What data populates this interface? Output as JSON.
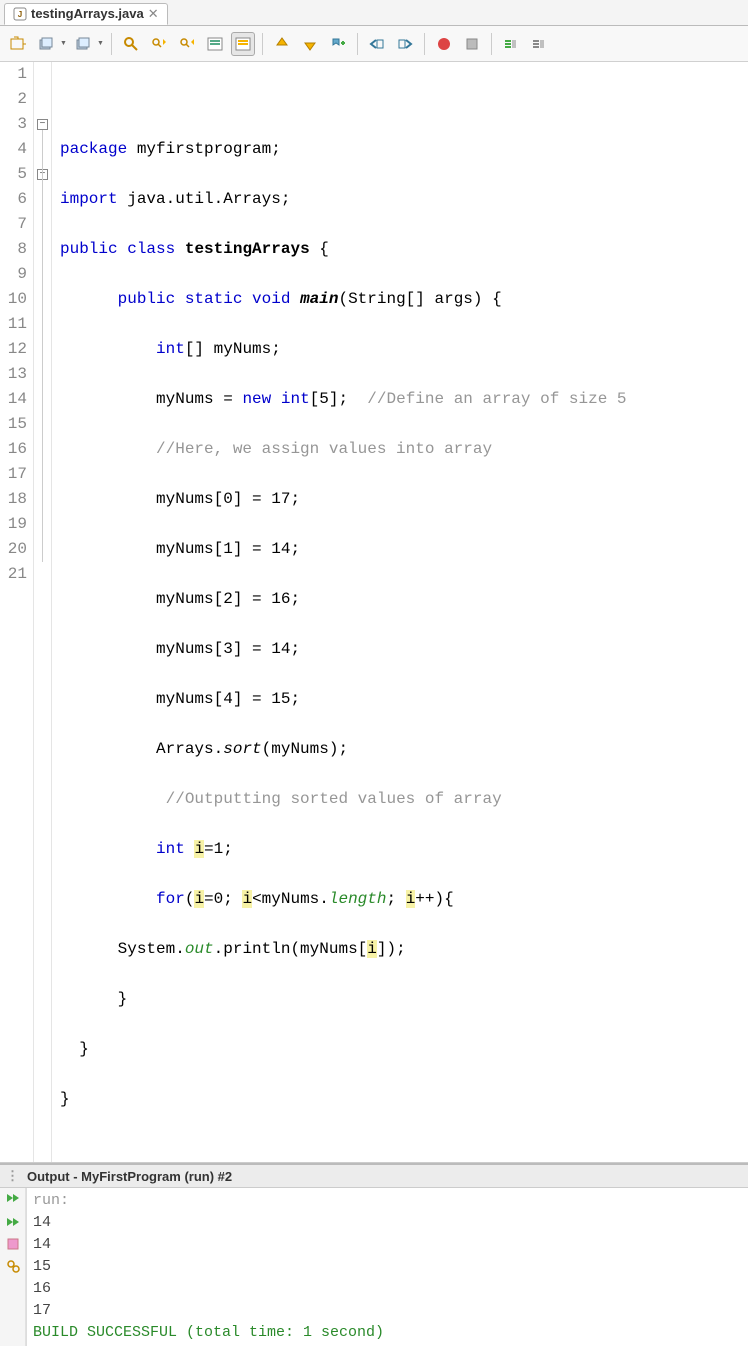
{
  "tab": {
    "filename": "testingArrays.java"
  },
  "editor": {
    "lines": {
      "1": "",
      "2": "package myfirstprogram;",
      "3": "import java.util.Arrays;",
      "4": "public class testingArrays {",
      "5": "      public static void main(String[] args) {",
      "6": "          int[] myNums;",
      "7": "          myNums = new int[5];  //Define an array of size 5",
      "8": "          //Here, we assign values into array",
      "9": "          myNums[0] = 17;",
      "10": "          myNums[1] = 14;",
      "11": "          myNums[2] = 16;",
      "12": "          myNums[3] = 14;",
      "13": "          myNums[4] = 15;",
      "14": "          Arrays.sort(myNums);",
      "15": "           //Outputting sorted values of array",
      "16": "          int i=1;",
      "17": "          for(i=0; i<myNums.length; i++){",
      "18": "      System.out.println(myNums[i]);",
      "19": "      }",
      "20": "  }",
      "21": "}"
    },
    "line_numbers": [
      "1",
      "2",
      "3",
      "4",
      "5",
      "6",
      "7",
      "8",
      "9",
      "10",
      "11",
      "12",
      "13",
      "14",
      "15",
      "16",
      "17",
      "18",
      "19",
      "20",
      "21"
    ]
  },
  "output": {
    "title": "Output - MyFirstProgram (run) #2",
    "lines": {
      "run": "run:",
      "v1": "14",
      "v2": "14",
      "v3": "15",
      "v4": "16",
      "v5": "17",
      "build": "BUILD SUCCESSFUL (total time: 1 second)"
    }
  }
}
